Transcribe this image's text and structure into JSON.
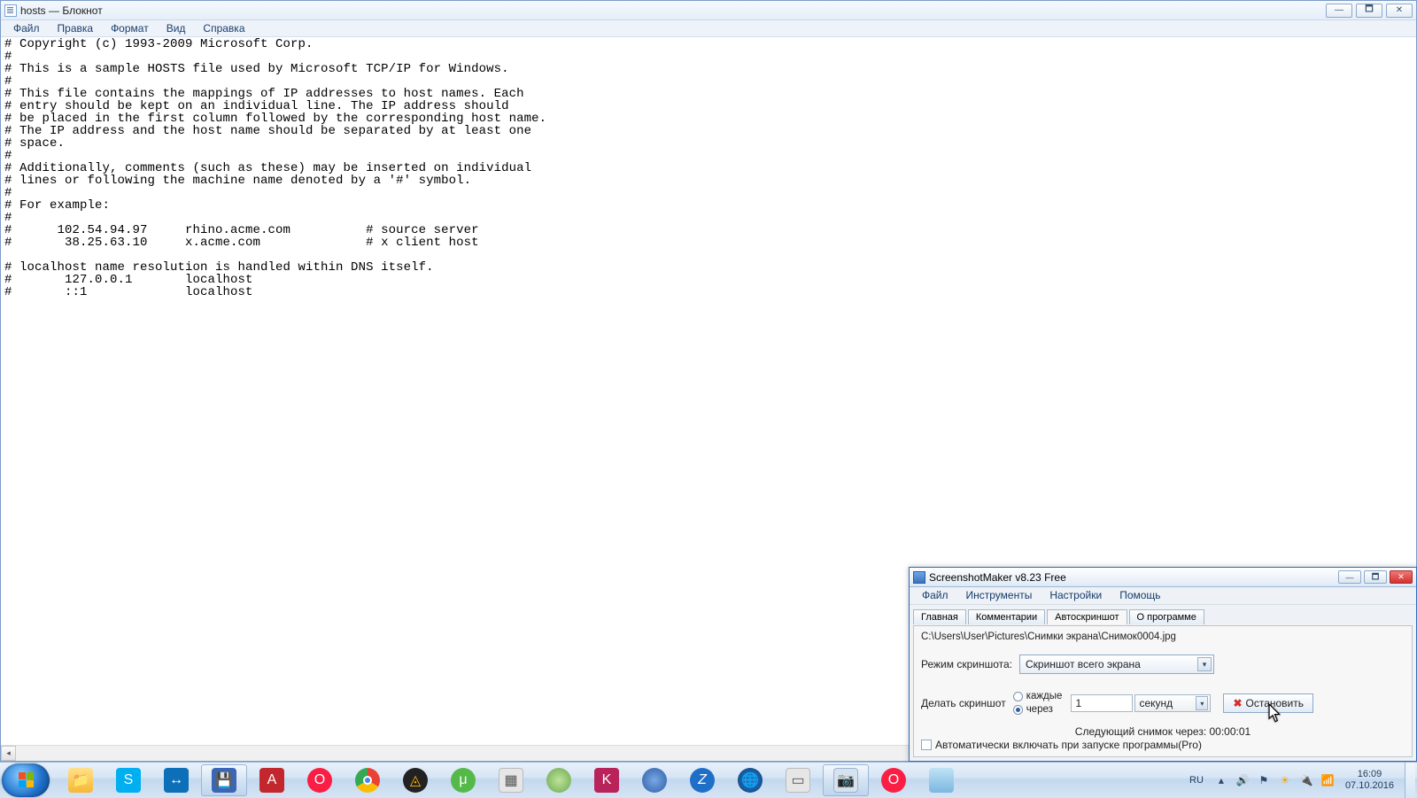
{
  "notepad": {
    "title": "hosts — Блокнот",
    "menu": {
      "file": "Файл",
      "edit": "Правка",
      "format": "Формат",
      "view": "Вид",
      "help": "Справка"
    },
    "content": "# Copyright (c) 1993-2009 Microsoft Corp.\n#\n# This is a sample HOSTS file used by Microsoft TCP/IP for Windows.\n#\n# This file contains the mappings of IP addresses to host names. Each\n# entry should be kept on an individual line. The IP address should\n# be placed in the first column followed by the corresponding host name.\n# The IP address and the host name should be separated by at least one\n# space.\n#\n# Additionally, comments (such as these) may be inserted on individual\n# lines or following the machine name denoted by a '#' symbol.\n#\n# For example:\n#\n#      102.54.94.97     rhino.acme.com          # source server\n#       38.25.63.10     x.acme.com              # x client host\n\n# localhost name resolution is handled within DNS itself.\n#\t127.0.0.1       localhost\n#\t::1             localhost"
  },
  "sm": {
    "title": "ScreenshotMaker v8.23 Free",
    "menu": {
      "file": "Файл",
      "tools": "Инструменты",
      "settings": "Настройки",
      "help": "Помощь"
    },
    "tabs": {
      "main": "Главная",
      "comments": "Комментарии",
      "auto": "Автоскриншот",
      "about": "О программе"
    },
    "path": "C:\\Users\\User\\Pictures\\Снимки экрана\\Снимок0004.jpg",
    "mode_label": "Режим скриншота:",
    "mode_value": "Скриншот всего экрана",
    "do_label": "Делать скриншот",
    "radio_every": "каждые",
    "radio_after": "через",
    "interval_value": "1",
    "unit_value": "секунд",
    "stop_label": "Остановить",
    "next_label": "Следующий снимок через: 00:00:01",
    "autostart_label": "Автоматически включать при запуске программы(Pro)"
  },
  "taskbar": {
    "lang": "RU",
    "time": "16:09",
    "date": "07.10.2016"
  }
}
